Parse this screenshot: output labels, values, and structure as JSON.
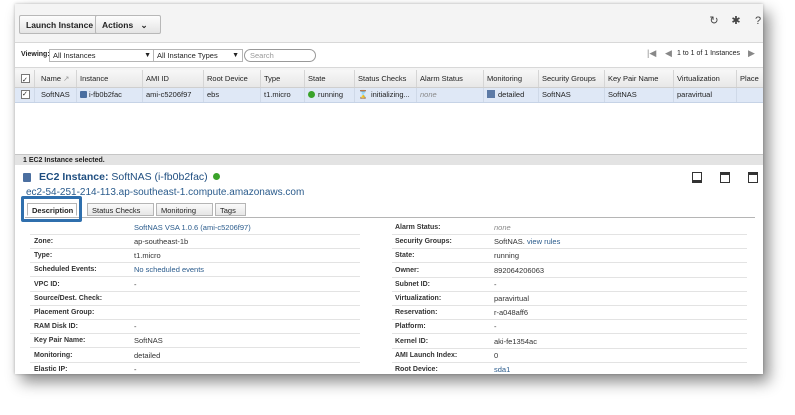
{
  "toolbar": {
    "launch_label": "Launch Instance",
    "actions_label": "Actions",
    "actions_caret": "⌄"
  },
  "filter": {
    "viewing_label": "Viewing:",
    "instances_value": "All Instances",
    "types_value": "All Instance Types",
    "search_placeholder": "Search",
    "pagination_text": "1 to 1 of 1 Instances"
  },
  "grid": {
    "columns": [
      "Name",
      "Instance",
      "AMI ID",
      "Root Device",
      "Type",
      "State",
      "Status Checks",
      "Alarm Status",
      "Monitoring",
      "Security Groups",
      "Key Pair Name",
      "Virtualization",
      "Place"
    ],
    "row": {
      "name": "SoftNAS",
      "instance": "i-fb0b2fac",
      "ami_id": "ami-c5206f97",
      "root_device": "ebs",
      "type": "t1.micro",
      "state": "running",
      "status_checks": "initializing...",
      "alarm_status": "none",
      "monitoring": "detailed",
      "security_groups": "SoftNAS",
      "key_pair": "SoftNAS",
      "virtualization": "paravirtual"
    }
  },
  "status_bar": "1 EC2 Instance selected.",
  "details": {
    "title_prefix": "EC2 Instance:",
    "title_name": "SoftNAS (i-fb0b2fac)",
    "dns": "ec2-54-251-214-113.ap-southeast-1.compute.amazonaws.com",
    "tabs": [
      "Description",
      "Status Checks",
      "Monitoring",
      "Tags"
    ],
    "ami_value": "SoftNAS VSA 1.0.6 (ami-c5206f97)",
    "left": [
      {
        "k": "Zone:",
        "v": "ap-southeast-1b"
      },
      {
        "k": "Type:",
        "v": "t1.micro"
      },
      {
        "k": "Scheduled Events:",
        "v": "No scheduled events"
      },
      {
        "k": "VPC ID:",
        "v": "-"
      },
      {
        "k": "Source/Dest. Check:",
        "v": ""
      },
      {
        "k": "Placement Group:",
        "v": ""
      },
      {
        "k": "RAM Disk ID:",
        "v": "-"
      },
      {
        "k": "Key Pair Name:",
        "v": "SoftNAS"
      },
      {
        "k": "Monitoring:",
        "v": "detailed"
      },
      {
        "k": "Elastic IP:",
        "v": "-"
      }
    ],
    "right": [
      {
        "k": "Alarm Status:",
        "v": "none"
      },
      {
        "k": "Security Groups:",
        "v": "SoftNAS.",
        "link": "view rules"
      },
      {
        "k": "State:",
        "v": "running"
      },
      {
        "k": "Owner:",
        "v": "892064206063"
      },
      {
        "k": "Subnet ID:",
        "v": "-"
      },
      {
        "k": "Virtualization:",
        "v": "paravirtual"
      },
      {
        "k": "Reservation:",
        "v": "r-a048aff6"
      },
      {
        "k": "Platform:",
        "v": "-"
      },
      {
        "k": "Kernel ID:",
        "v": "aki-fe1354ac"
      },
      {
        "k": "AMI Launch Index:",
        "v": "0"
      },
      {
        "k": "Root Device:",
        "v": "sda1"
      }
    ]
  },
  "colors": {
    "accent": "#2f6fad",
    "link": "#2a5b8c",
    "selected_row": "#dfe8f6",
    "running": "#3aa32a"
  }
}
